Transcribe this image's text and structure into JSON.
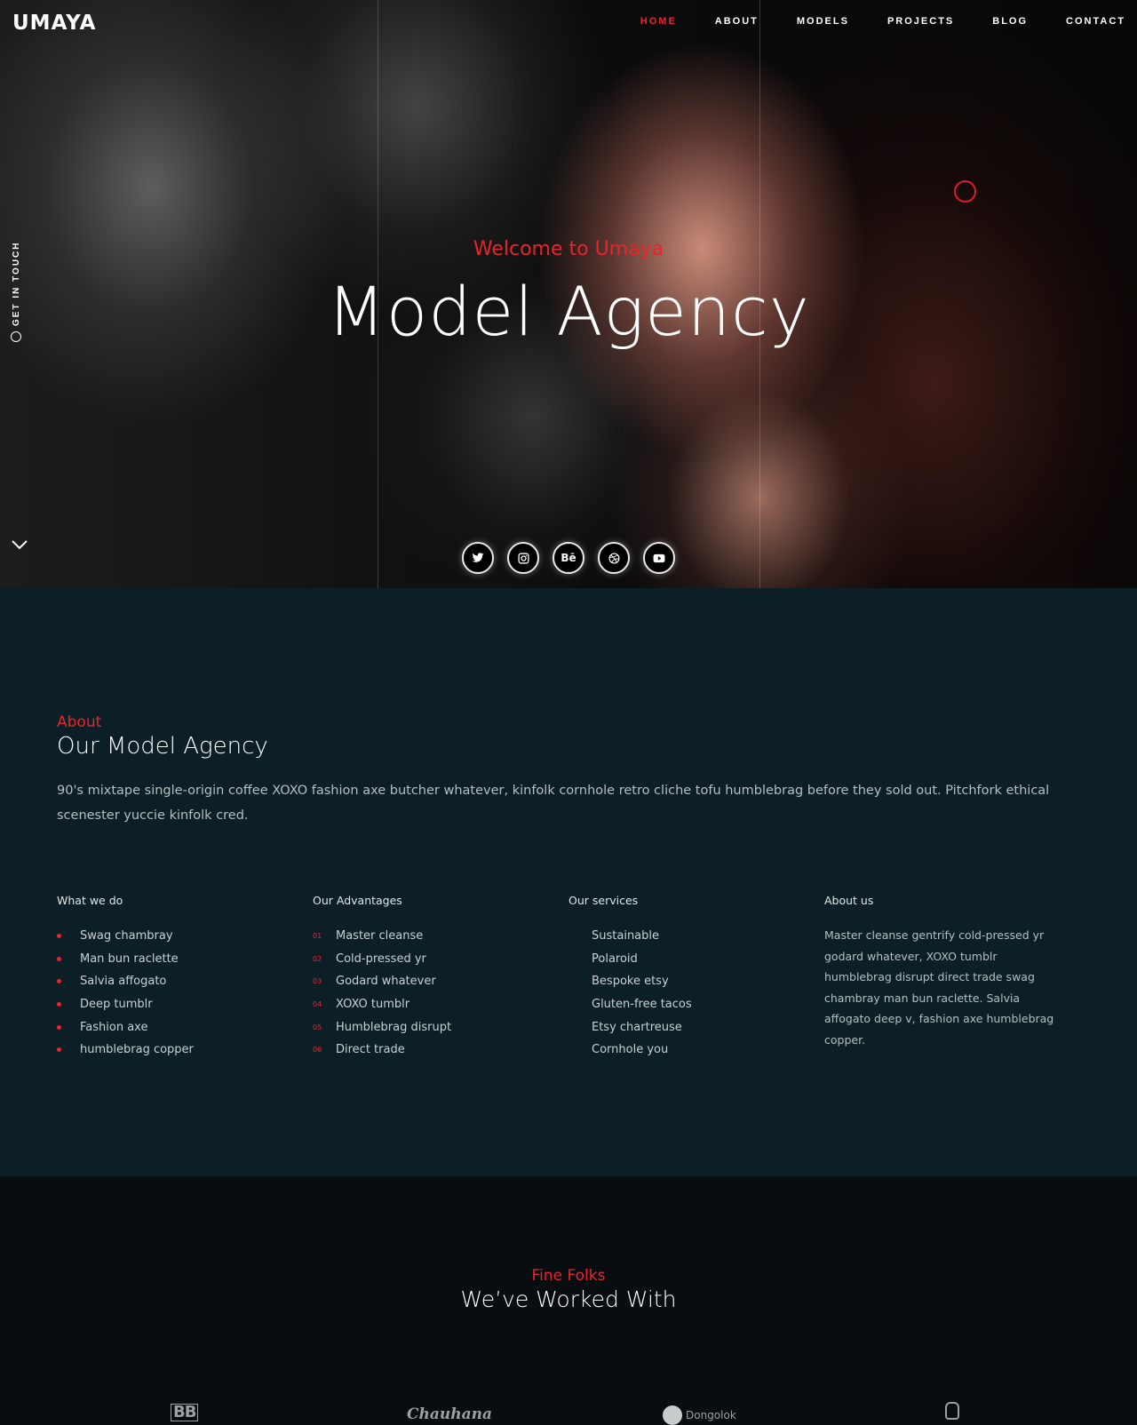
{
  "brand": {
    "logo_text": "UMAYA"
  },
  "nav": {
    "items": [
      {
        "label": "HOME",
        "active": true
      },
      {
        "label": "ABOUT",
        "active": false
      },
      {
        "label": "MODELS",
        "active": false
      },
      {
        "label": "PROJECTS",
        "active": false
      },
      {
        "label": "BLOG",
        "active": false
      },
      {
        "label": "CONTACT",
        "active": false
      }
    ]
  },
  "hero": {
    "subtitle": "Welcome to Umaya",
    "title": "Model Agency",
    "side_link": "GET IN TOUCH",
    "socials": [
      {
        "icon": "twitter-icon"
      },
      {
        "icon": "instagram-icon"
      },
      {
        "icon": "behance-icon",
        "glyph": "Bē"
      },
      {
        "icon": "dribbble-icon"
      },
      {
        "icon": "youtube-icon"
      }
    ]
  },
  "about": {
    "kicker": "About",
    "title": "Our Model Agency",
    "intro": "90's mixtape single-origin coffee XOXO fashion axe butcher whatever, kinfolk cornhole retro cliche tofu humblebrag before they sold out. Pitchfork ethical scenester yuccie kinfolk cred.",
    "what_we_do": {
      "heading": "What we do",
      "items": [
        "Swag chambray",
        "Man bun raclette",
        "Salvia affogato",
        "Deep tumblr",
        "Fashion axe",
        "humblebrag copper"
      ]
    },
    "advantages": {
      "heading": "Our Advantages",
      "items": [
        {
          "num": "01",
          "label": "Master cleanse"
        },
        {
          "num": "02",
          "label": "Cold-pressed yr"
        },
        {
          "num": "03",
          "label": "Godard whatever"
        },
        {
          "num": "04",
          "label": "XOXO tumblr"
        },
        {
          "num": "05",
          "label": "Humblebrag disrupt"
        },
        {
          "num": "06",
          "label": "Direct trade"
        }
      ]
    },
    "services": {
      "heading": "Our services",
      "items": [
        "Sustainable",
        "Polaroid",
        "Bespoke etsy",
        "Gluten-free tacos",
        "Etsy chartreuse",
        "Cornhole you"
      ]
    },
    "about_us": {
      "heading": "About us",
      "text": "Master cleanse gentrify cold-pressed yr godard whatever, XOXO tumblr humblebrag disrupt direct trade swag chambray man bun raclette. Salvia affogato deep v, fashion axe humblebrag copper."
    }
  },
  "clients": {
    "kicker": "Fine Folks",
    "title": "We’ve Worked With",
    "logos": [
      "BB",
      "Chauhana",
      "Dongolok"
    ]
  },
  "colors": {
    "accent": "#e8242c",
    "about_bg": "#0c1f26",
    "clients_bg": "#070d10"
  }
}
